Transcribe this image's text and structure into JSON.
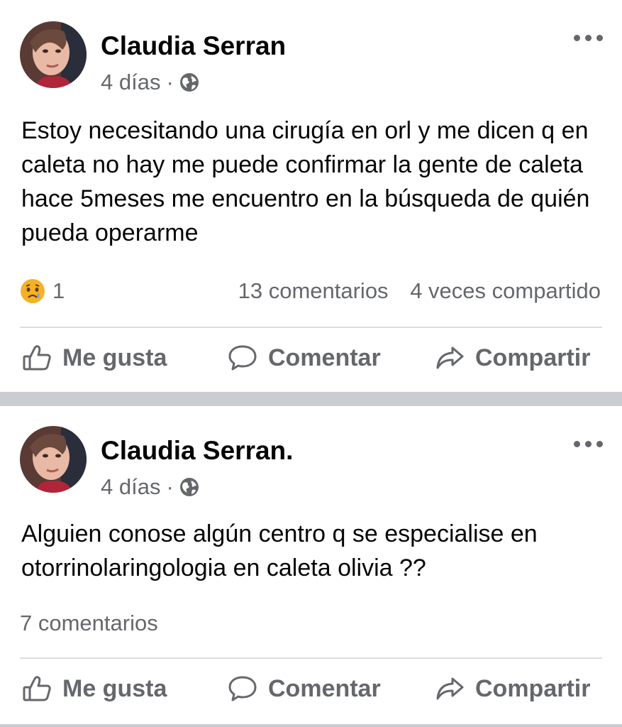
{
  "posts": [
    {
      "author": "Claudia Serran",
      "time": "4 días",
      "separator": "·",
      "body": "Estoy necesitando una cirugía en orl y me dicen q en caleta no hay me puede confirmar la gente de caleta hace 5meses me encuentro en la búsqueda de quién pueda operarme",
      "reaction_count": "1",
      "comments": "13 comentarios",
      "shares": "4 veces compartido",
      "actions": {
        "like": "Me gusta",
        "comment": "Comentar",
        "share": "Compartir"
      }
    },
    {
      "author": "Claudia Serran.",
      "time": "4 días",
      "separator": "·",
      "body": "Alguien conose algún centro q se especialise en otorrinolaringologia en caleta olivia ??",
      "comments": "7 comentarios",
      "actions": {
        "like": "Me gusta",
        "comment": "Comentar",
        "share": "Compartir"
      }
    }
  ],
  "icons": {
    "more": "more-icon",
    "privacy": "globe-icon",
    "reaction": "sad-reaction-icon",
    "like": "thumbs-up-icon",
    "comment": "comment-icon",
    "share": "share-icon"
  },
  "colors": {
    "text": "#050505",
    "secondary": "#65676b",
    "divider": "#dadde1",
    "separator": "#c9ccd1",
    "reaction_yellow": "#f7b125"
  }
}
